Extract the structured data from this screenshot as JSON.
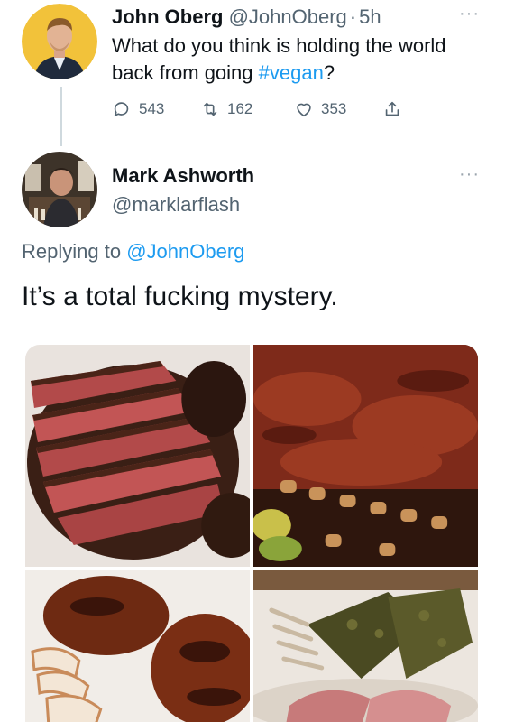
{
  "tweet": {
    "author_name": "John Oberg",
    "author_handle": "@JohnOberg",
    "separator": "·",
    "time": "5h",
    "text_before": "What do you think is holding the world back from going ",
    "hashtag": "#vegan",
    "text_after": "?",
    "replies": "543",
    "retweets": "162",
    "likes": "353",
    "more_icon": "more-dots-icon"
  },
  "reply": {
    "author_name": "Mark Ashworth",
    "author_handle": "@marklarflash",
    "replying_to_label": "Replying to",
    "replying_to_handle": "@JohnOberg",
    "text": "It’s a total fucking mystery.",
    "more_icon": "more-dots-icon"
  },
  "colors": {
    "link": "#1d9bf0",
    "muted": "#536471",
    "thread_line": "#cfd9de"
  },
  "photos": [
    "sliced-steak-photo",
    "bbq-ribs-photo",
    "grilled-chicken-photo",
    "rack-of-lamb-photo"
  ]
}
